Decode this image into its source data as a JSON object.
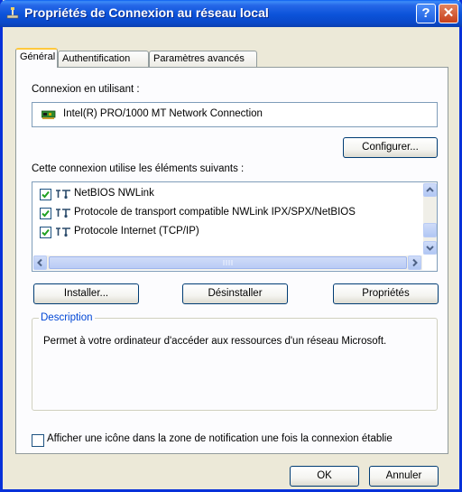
{
  "window": {
    "title": "Propriétés de Connexion au réseau local",
    "help": "?",
    "close": "✕"
  },
  "tabs": [
    {
      "label": "Général",
      "active": true
    },
    {
      "label": "Authentification",
      "active": false
    },
    {
      "label": "Paramètres avancés",
      "active": false
    }
  ],
  "general": {
    "connect_using_label": "Connexion en utilisant :",
    "adapter_name": "Intel(R) PRO/1000 MT Network Connection",
    "configure_button": "Configurer...",
    "components_label": "Cette connexion utilise les éléments suivants :",
    "components": [
      {
        "label": "NetBIOS NWLink",
        "checked": true
      },
      {
        "label": "Protocole de transport compatible NWLink IPX/SPX/NetBIOS",
        "checked": true
      },
      {
        "label": "Protocole Internet (TCP/IP)",
        "checked": true
      }
    ],
    "install_button": "Installer...",
    "uninstall_button": "Désinstaller",
    "properties_button": "Propriétés",
    "description_title": "Description",
    "description_text": "Permet à votre ordinateur d'accéder aux ressources d'un réseau Microsoft.",
    "notify_checkbox_label": "Afficher une icône dans la zone de notification une fois la connexion établie",
    "notify_checked": false
  },
  "footer": {
    "ok_button": "OK",
    "cancel_button": "Annuler"
  },
  "colors": {
    "titlebar": "#0b52d9",
    "dialog_bg": "#ece9d8",
    "panel_bg": "#fcfcfe",
    "group_title": "#0046d5"
  }
}
